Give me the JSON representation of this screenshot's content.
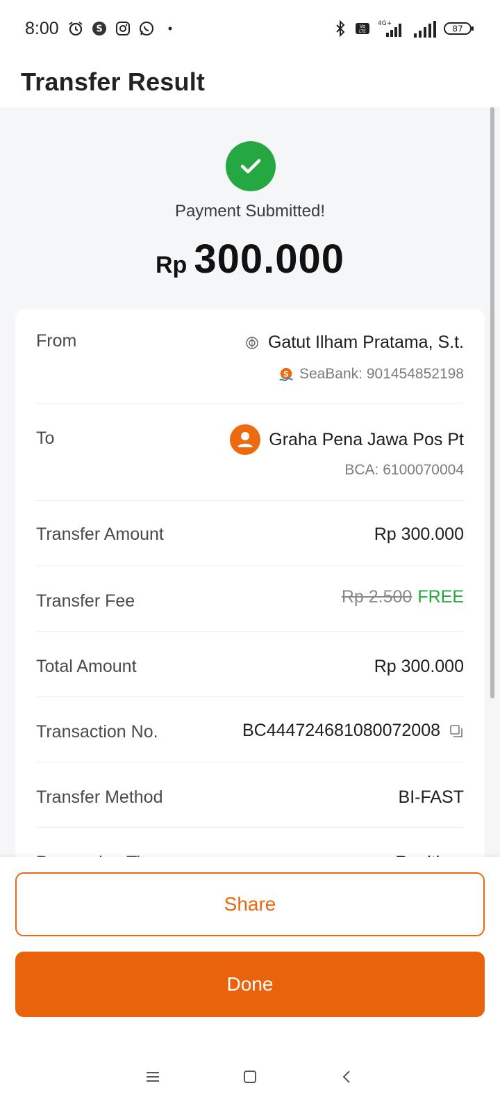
{
  "status_bar": {
    "time": "8:00",
    "battery": "87",
    "network": "4G+",
    "icons": [
      "alarm-icon",
      "shopee-icon",
      "instagram-icon",
      "whatsapp-icon",
      "dot-icon",
      "bluetooth-icon",
      "volte-icon",
      "signal-icon",
      "signal-icon",
      "battery-icon"
    ]
  },
  "header": {
    "title": "Transfer Result"
  },
  "result": {
    "status_text": "Payment Submitted!",
    "currency": "Rp",
    "amount": "300.000"
  },
  "details": {
    "from": {
      "label": "From",
      "name": "Gatut Ilham Pratama, S.t.",
      "account": "SeaBank: 901454852198"
    },
    "to": {
      "label": "To",
      "name": "Graha Pena Jawa Pos Pt",
      "account": "BCA: 6100070004"
    },
    "transfer_amount": {
      "label": "Transfer Amount",
      "value": "Rp 300.000"
    },
    "transfer_fee": {
      "label": "Transfer Fee",
      "original": "Rp 2.500",
      "value": "FREE"
    },
    "total_amount": {
      "label": "Total Amount",
      "value": "Rp 300.000"
    },
    "transaction_no": {
      "label": "Transaction No.",
      "value": "BC444724681080072008"
    },
    "transfer_method": {
      "label": "Transfer Method",
      "value": "BI-FAST"
    },
    "processing_time": {
      "label": "Processing Time",
      "value": "Realtime"
    }
  },
  "buttons": {
    "share": "Share",
    "done": "Done"
  },
  "colors": {
    "accent": "#e8630c",
    "success": "#25a742",
    "background": "#f5f6f8"
  }
}
